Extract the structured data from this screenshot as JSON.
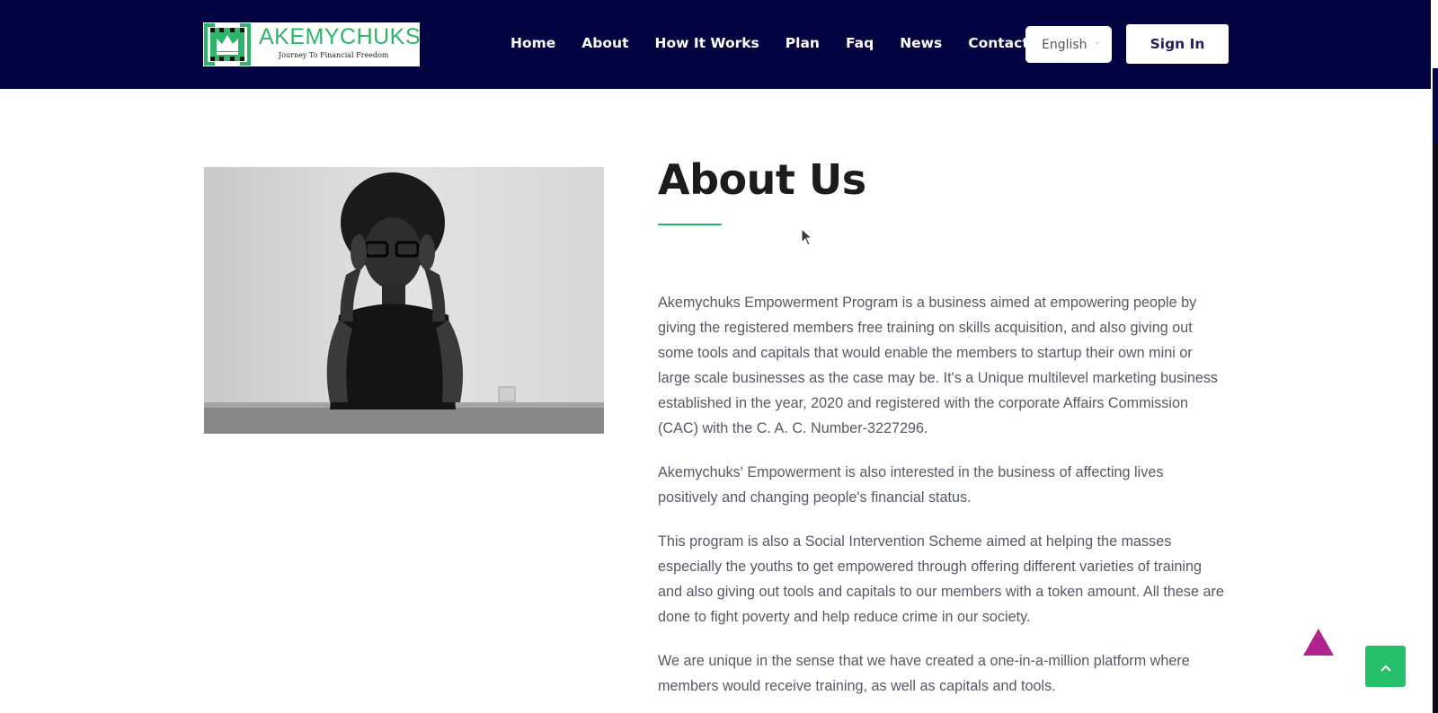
{
  "brand": {
    "name": "AKEMYCHUKS",
    "tagline": "Journey To Financial Freedom",
    "logo_icon": "crown-icon",
    "color": "#2fb56a"
  },
  "nav": {
    "items": [
      {
        "label": "Home"
      },
      {
        "label": "About"
      },
      {
        "label": "How It Works"
      },
      {
        "label": "Plan"
      },
      {
        "label": "Faq"
      },
      {
        "label": "News"
      },
      {
        "label": "Contact"
      }
    ],
    "language": "English",
    "signin_label": "Sign In"
  },
  "about": {
    "title": "About Us",
    "paragraphs": [
      "Akemychuks Empowerment Program is a business aimed at empowering people by giving the registered members free training on skills acquisition, and also giving out some tools and capitals that would enable the members to startup their own mini or large scale businesses as the case may be. It's a Unique multilevel marketing business established in the year, 2020 and registered with the corporate Affairs Commission (CAC) with the C. A. C. Number-3227296.",
      "Akemychuks' Empowerment is also interested in the business of affecting lives positively and changing people's financial status.",
      "This program is also a  Social Intervention Scheme aimed at helping the masses especially the youths to get empowered through offering different varieties of training and also giving out tools and capitals to our members with a token amount. All these are done to fight poverty and help reduce crime in our society.",
      "We are unique in the sense that we have created a one-in-a-million platform where members would receive training, as well as capitals and tools."
    ]
  },
  "colors": {
    "header_bg": "#020442",
    "accent_green": "#26c06c",
    "triangle": "#b0238e"
  },
  "icons": {
    "scroll_top": "chevron-up-icon",
    "decor": "triangle-icon"
  }
}
